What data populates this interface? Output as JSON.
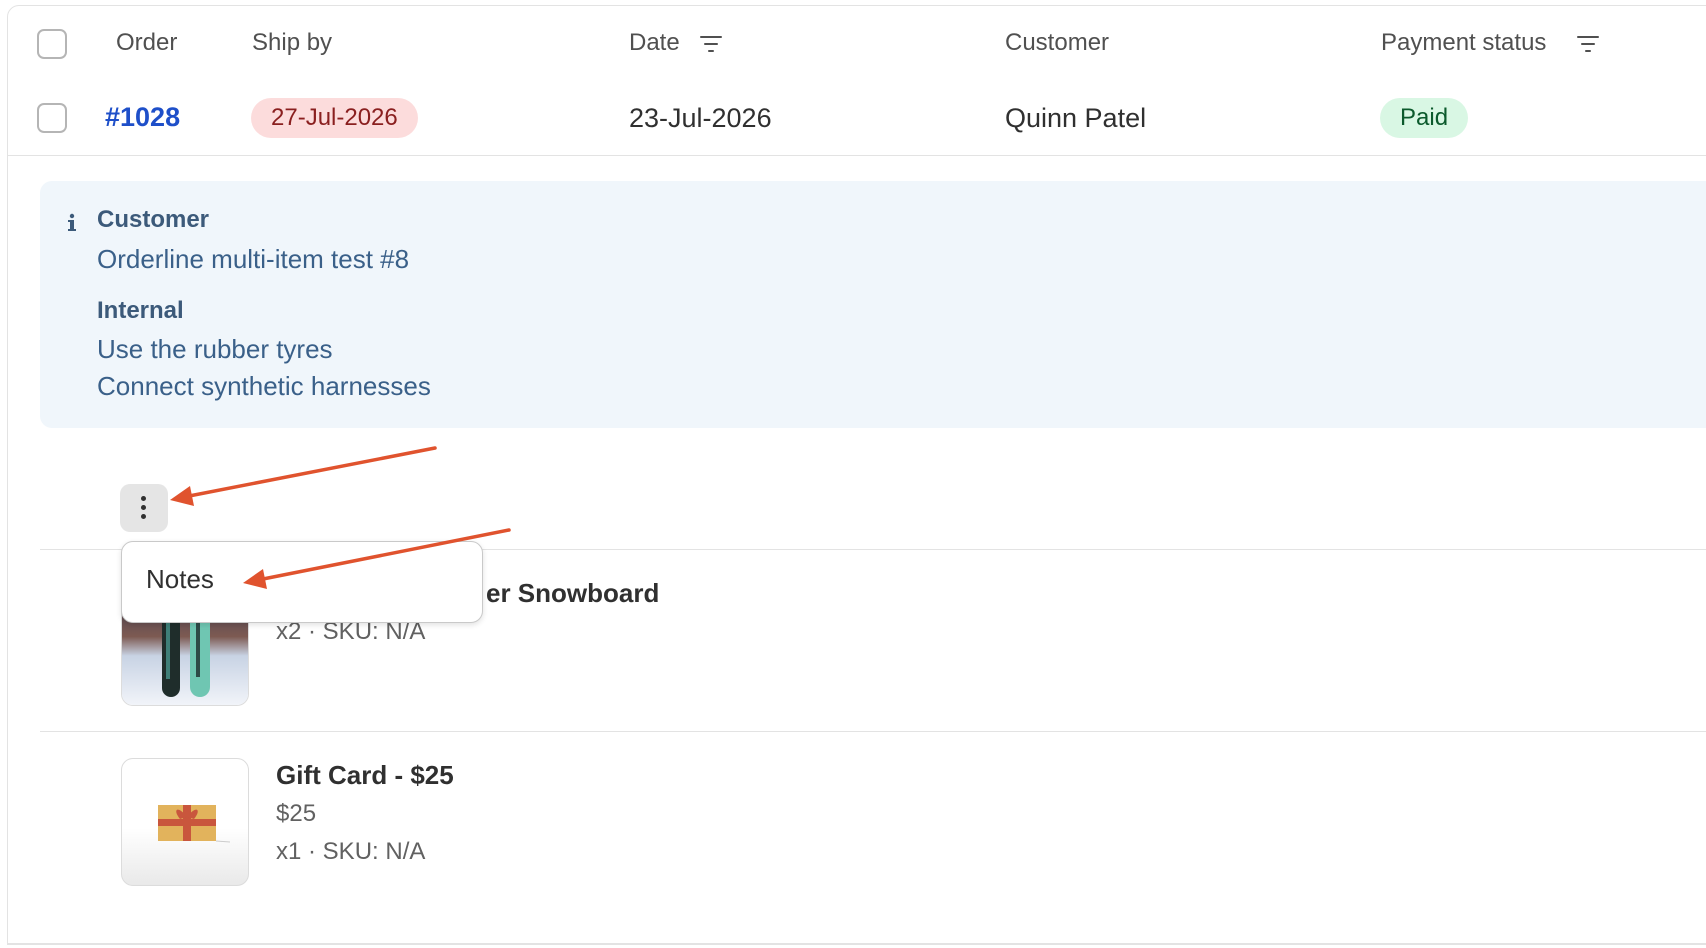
{
  "table": {
    "columns": {
      "order": "Order",
      "ship_by": "Ship by",
      "date": "Date",
      "customer": "Customer",
      "payment_status": "Payment status"
    },
    "row": {
      "order": "#1028",
      "ship_by": "27-Jul-2026",
      "date": "23-Jul-2026",
      "customer": "Quinn Patel",
      "payment_status": "Paid"
    }
  },
  "notes": {
    "customer_label": "Customer",
    "customer_note": "Orderline multi-item test #8",
    "internal_label": "Internal",
    "internal_notes": [
      "Use the rubber tyres",
      "Connect synthetic harnesses"
    ]
  },
  "menu": {
    "items": [
      "Notes"
    ]
  },
  "line_items": [
    {
      "title": "er Snowboard",
      "meta": "x2 · SKU: N/A"
    },
    {
      "title": "Gift Card - $25",
      "price": "$25",
      "meta": "x1 · SKU: N/A"
    }
  ],
  "icons": {
    "info": "info-icon",
    "filter": "filter-icon",
    "more": "more-vertical-icon"
  },
  "colors": {
    "link": "#1e4fc9",
    "ship_badge_bg": "#fcdcdc",
    "paid_badge_bg": "#d9f7e4",
    "notes_bg": "#f0f6fb",
    "annotation_arrow": "#e0532e"
  }
}
